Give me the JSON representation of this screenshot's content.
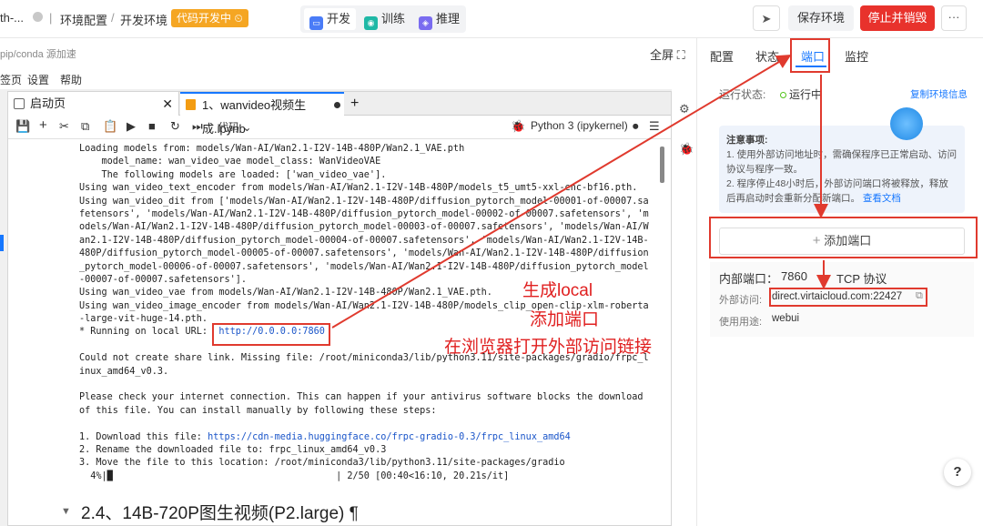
{
  "header": {
    "crumb_truncated": "th-...",
    "crumb_env": "环境配置",
    "crumb_dev_env": "开发环境",
    "dev_tag": "代码开发中",
    "modes": [
      {
        "label": "开发",
        "icon": "dev-icon"
      },
      {
        "label": "训练",
        "icon": "train-icon"
      },
      {
        "label": "推理",
        "icon": "infer-icon"
      }
    ],
    "save_label": "保存环境",
    "stop_label": "停止并销毁",
    "more_label": "···"
  },
  "subbar": {
    "left_text": "pip/conda 源加速",
    "fullscreen_label": "全屏"
  },
  "menubar": {
    "items": [
      "签页",
      "设置",
      "帮助"
    ]
  },
  "notebook": {
    "tab1_label": "启动页",
    "tab2_label": "1、wanvideo视频生成.ipynb",
    "tab_add": "+",
    "kernel_label": "Python 3 (ipykernel)",
    "cell_type": "代码",
    "output_lines": [
      "Loading models from: models/Wan-AI/Wan2.1-I2V-14B-480P/Wan2.1_VAE.pth",
      "    model_name: wan_video_vae model_class: WanVideoVAE",
      "    The following models are loaded: ['wan_video_vae'].",
      "Using wan_video_text_encoder from models/Wan-AI/Wan2.1-I2V-14B-480P/models_t5_umt5-xxl-enc-bf16.pth.",
      "Using wan_video_dit from ['models/Wan-AI/Wan2.1-I2V-14B-480P/diffusion_pytorch_model-00001-of-00007.sa",
      "fetensors', 'models/Wan-AI/Wan2.1-I2V-14B-480P/diffusion_pytorch_model-00002-of-00007.safetensors', 'm",
      "odels/Wan-AI/Wan2.1-I2V-14B-480P/diffusion_pytorch_model-00003-of-00007.safetensors', 'models/Wan-AI/W",
      "an2.1-I2V-14B-480P/diffusion_pytorch_model-00004-of-00007.safetensors', 'models/Wan-AI/Wan2.1-I2V-14B-",
      "480P/diffusion_pytorch_model-00005-of-00007.safetensors', 'models/Wan-AI/Wan2.1-I2V-14B-480P/diffusion",
      "_pytorch_model-00006-of-00007.safetensors', 'models/Wan-AI/Wan2.1-I2V-14B-480P/diffusion_pytorch_model",
      "-00007-of-00007.safetensors'].",
      "Using wan_video_vae from models/Wan-AI/Wan2.1-I2V-14B-480P/Wan2.1_VAE.pth.",
      "Using wan_video_image_encoder from models/Wan-AI/Wan2.1-I2V-14B-480P/models_clip_open-clip-xlm-roberta",
      "-large-vit-huge-14.pth."
    ],
    "running_prefix": "* Running on local URL:  ",
    "running_url": "http://0.0.0.0:7860",
    "output_lines_2": [
      "",
      "Could not create share link. Missing file: /root/miniconda3/lib/python3.11/site-packages/gradio/frpc_l",
      "inux_amd64_v0.3.",
      "",
      "Please check your internet connection. This can happen if your antivirus software blocks the download",
      "of this file. You can install manually by following these steps:",
      "",
      "1. Download this file: "
    ],
    "download_url": "https://cdn-media.huggingface.co/frpc-gradio-0.3/frpc_linux_amd64",
    "output_lines_3": [
      "2. Rename the downloaded file to: frpc_linux_amd64_v0.3",
      "3. Move the file to this location: /root/miniconda3/lib/python3.11/site-packages/gradio",
      "  4%|█                                        | 2/50 [00:40<16:10, 20.21s/it]"
    ],
    "heading": "2.4、14B-720P图生视频(P2.large) ¶"
  },
  "right_panel": {
    "tabs": [
      "配置",
      "状态",
      "端口",
      "监控"
    ],
    "active_tab": "端口",
    "status_label": "运行状态:",
    "status_value": "运行中",
    "copy_info": "复制环境信息",
    "notice_title": "注意事项:",
    "notice_1": "1. 使用外部访问地址时，需确保程序已正常启动、访问协议与程序一致。",
    "notice_2": "2. 程序停止48小时后，外部访问端口将被释放，释放后再启动时会重新分配新端口。",
    "notice_link": "查看文档",
    "add_port_label": "添加端口",
    "internal_port_label": "内部端口：",
    "internal_port_value": "7860",
    "protocol": "TCP 协议",
    "external_label": "外部访问:",
    "external_value": "direct.virtaicloud.com:22427",
    "usage_label": "使用用途:",
    "usage_value": "webui",
    "help_label": "?"
  },
  "annotations": {
    "line1": "生成local",
    "line2": "添加端口",
    "line3": "在浏览器打开外部访问链接"
  },
  "colors": {
    "accent": "#1677ff",
    "danger": "#e8322c",
    "annotation": "#e02020",
    "tag": "#f5a623"
  }
}
